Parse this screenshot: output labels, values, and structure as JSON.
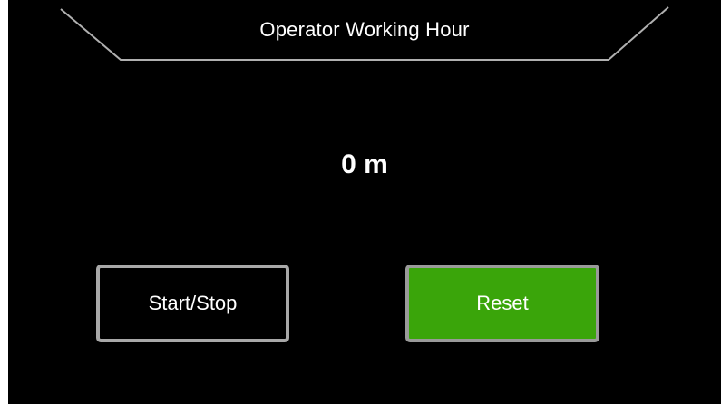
{
  "header": {
    "title": "Operator Working Hour"
  },
  "timer": {
    "value": "0 m"
  },
  "buttons": {
    "start_stop_label": "Start/Stop",
    "reset_label": "Reset"
  },
  "colors": {
    "background": "#000000",
    "text": "#ffffff",
    "reset_button": "#3aa50a",
    "button_border": "#a8a8a8"
  }
}
